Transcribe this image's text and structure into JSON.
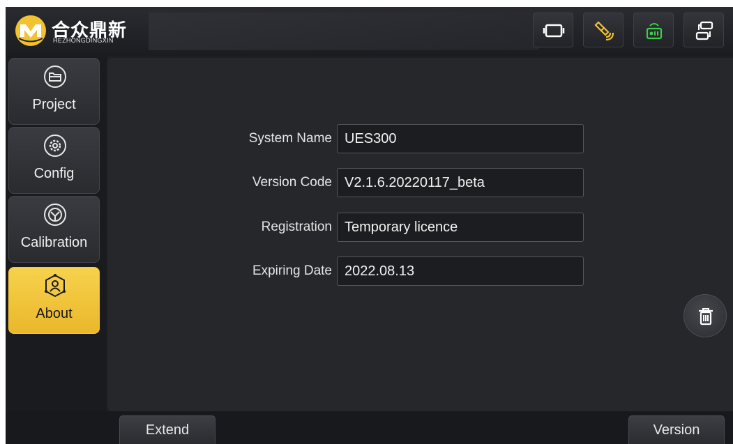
{
  "brand": {
    "name_cn": "合众鼎新",
    "name_en": "HEZHONGDINGXIN",
    "accent_color": "#f2c230"
  },
  "status_icons": [
    {
      "name": "screen-frame-icon",
      "color": "#ffffff"
    },
    {
      "name": "satellite-icon",
      "color": "#f2c230"
    },
    {
      "name": "radio-signal-icon",
      "color": "#3ecb4f"
    },
    {
      "name": "connection-switch-icon",
      "color": "#ffffff"
    }
  ],
  "sidebar": {
    "items": [
      {
        "label": "Project",
        "icon": "folder-icon"
      },
      {
        "label": "Config",
        "icon": "gear-config-icon"
      },
      {
        "label": "Calibration",
        "icon": "calibration-icon"
      },
      {
        "label": "About",
        "icon": "about-network-icon",
        "active": true
      }
    ]
  },
  "about": {
    "fields": [
      {
        "label": "System Name",
        "value": "UES300"
      },
      {
        "label": "Version Code",
        "value": "V2.1.6.20220117_beta"
      },
      {
        "label": "Registration",
        "value": "Temporary licence"
      },
      {
        "label": "Expiring Date",
        "value": "2022.08.13"
      }
    ]
  },
  "actions": {
    "delete_icon": "trash-icon"
  },
  "bottom": {
    "extend_label": "Extend",
    "version_label": "Version"
  }
}
